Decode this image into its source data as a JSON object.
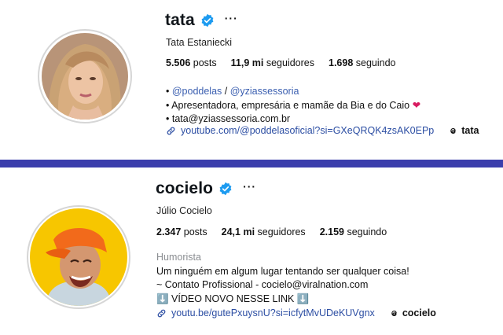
{
  "profiles": [
    {
      "username": "tata",
      "full_name": "Tata Estaniecki",
      "more_label": "···",
      "stats": {
        "posts_count": "5.506",
        "posts_label": "posts",
        "followers_count": "11,9 mi",
        "followers_label": "seguidores",
        "following_count": "1.698",
        "following_label": "seguindo"
      },
      "bio": {
        "line1_prefix": "• ",
        "mention1": "@poddelas",
        "separator": " / ",
        "mention2": "@yziassessoria",
        "line2": "• Apresentadora, empresária e mamãe da Bia e do Caio",
        "line2_emoji": "❤",
        "line3": "• tata@yziassessoria.com.br"
      },
      "link": "youtube.com/@poddelasoficial?si=GXeQRQK4zsAK0EPp",
      "threads": "tata"
    },
    {
      "username": "cocielo",
      "full_name": "Júlio Cocielo",
      "more_label": "···",
      "stats": {
        "posts_count": "2.347",
        "posts_label": "posts",
        "followers_count": "24,1 mi",
        "followers_label": "seguidores",
        "following_count": "2.159",
        "following_label": "seguindo"
      },
      "bio": {
        "category": "Humorista",
        "line1": "Um ninguém em algum lugar tentando ser qualquer coisa!",
        "line2": "~ Contato Profissional - cocielo@viralnation.com",
        "line3_emoji": "⬇️",
        "line3_text": " VÍDEO NOVO NESSE LINK ",
        "line3_emoji_end": "⬇️"
      },
      "link": "youtu.be/gutePxuysnU?si=icfytMvUDeKUVgnx",
      "threads": "cocielo"
    }
  ],
  "colors": {
    "divider": "#3b3eac",
    "verified": "#1d9bf0",
    "link": "#2c4ea3",
    "mention": "#3b5fb0",
    "category": "#8a8d91"
  }
}
